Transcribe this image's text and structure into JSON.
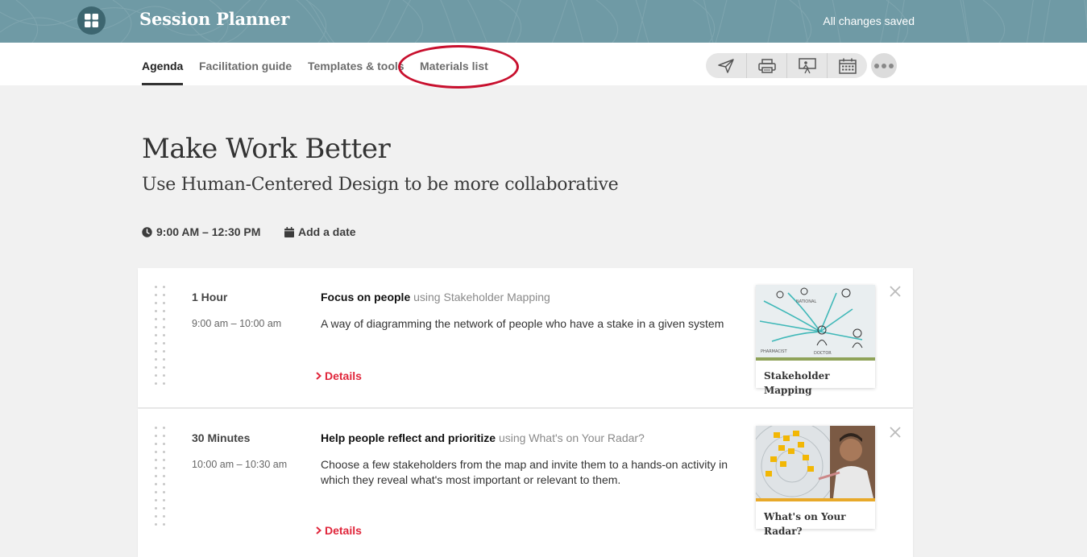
{
  "app": {
    "title": "Session Planner",
    "save_status": "All changes saved",
    "header_color": "#6f9aa5",
    "accent_color": "#e0263b"
  },
  "tabs": [
    {
      "label": "Agenda",
      "active": true
    },
    {
      "label": "Facilitation guide",
      "active": false
    },
    {
      "label": "Templates & tools",
      "active": false
    },
    {
      "label": "Materials list",
      "active": false,
      "highlighted": true
    }
  ],
  "toolbar": {
    "buttons": [
      "send-icon",
      "print-icon",
      "present-icon",
      "calendar-icon"
    ],
    "more": "more-icon"
  },
  "session": {
    "title": "Make Work Better",
    "subtitle": "Use Human-Centered Design to be more collaborative",
    "time_range": "9:00 AM – 12:30 PM",
    "date_action": "Add a date"
  },
  "agenda": {
    "items": [
      {
        "duration": "1 Hour",
        "time_range": "9:00 am – 10:00 am",
        "goal": "Focus on people",
        "using": "using Stakeholder Mapping",
        "description": "A way of diagramming the network of people who have a stake in a given system",
        "details_label": "Details",
        "method": {
          "name": "Stakeholder Mapping",
          "bar_color": "#8fa359"
        }
      },
      {
        "duration": "30 Minutes",
        "time_range": "10:00 am – 10:30 am",
        "goal": "Help people reflect and prioritize",
        "using": "using What's on Your Radar?",
        "description": "Choose a few stakeholders from the map and invite them to a hands-on activity in which they reveal what's most important or relevant to them.",
        "details_label": "Details",
        "method": {
          "name": "What's on Your Radar?",
          "bar_color": "#e8a92a"
        }
      }
    ]
  }
}
